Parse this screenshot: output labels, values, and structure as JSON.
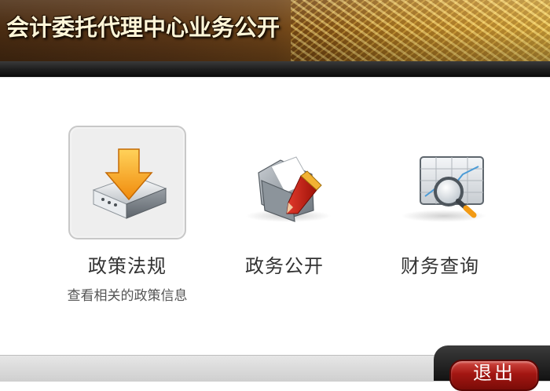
{
  "header": {
    "title": "会计委托代理中心业务公开"
  },
  "menu": [
    {
      "label": "政策法规",
      "description": "查看相关的政策信息",
      "icon": "download-drive-icon",
      "selected": true
    },
    {
      "label": "政务公开",
      "description": "",
      "icon": "folder-pencil-icon",
      "selected": false
    },
    {
      "label": "财务查询",
      "description": "",
      "icon": "chart-magnifier-icon",
      "selected": false
    }
  ],
  "footer": {
    "exit_label": "退出"
  },
  "colors": {
    "accent_gold": "#d7a43a",
    "exit_red": "#a31612",
    "arrow_orange": "#f29a14"
  }
}
